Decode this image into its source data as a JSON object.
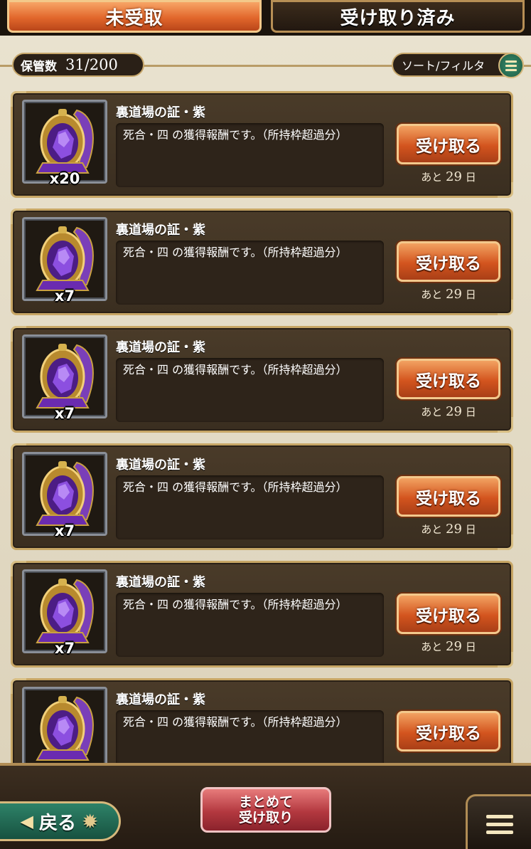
{
  "tabs": {
    "unclaimed": "未受取",
    "claimed": "受け取り済み"
  },
  "storage": {
    "label": "保管数",
    "value": "31/200"
  },
  "sort_filter": {
    "label": "ソート/フィルタ"
  },
  "items": [
    {
      "name": "裏道場の証・紫",
      "quantity": "x20",
      "description": "死合・四 の獲得報酬です。（所持枠超過分）",
      "button": "受け取る",
      "remaining_prefix": "あと",
      "remaining_days": "29",
      "remaining_suffix": "日"
    },
    {
      "name": "裏道場の証・紫",
      "quantity": "x7",
      "description": "死合・四 の獲得報酬です。（所持枠超過分）",
      "button": "受け取る",
      "remaining_prefix": "あと",
      "remaining_days": "29",
      "remaining_suffix": "日"
    },
    {
      "name": "裏道場の証・紫",
      "quantity": "x7",
      "description": "死合・四 の獲得報酬です。（所持枠超過分）",
      "button": "受け取る",
      "remaining_prefix": "あと",
      "remaining_days": "29",
      "remaining_suffix": "日"
    },
    {
      "name": "裏道場の証・紫",
      "quantity": "x7",
      "description": "死合・四 の獲得報酬です。（所持枠超過分）",
      "button": "受け取る",
      "remaining_prefix": "あと",
      "remaining_days": "29",
      "remaining_suffix": "日"
    },
    {
      "name": "裏道場の証・紫",
      "quantity": "x7",
      "description": "死合・四 の獲得報酬です。（所持枠超過分）",
      "button": "受け取る",
      "remaining_prefix": "あと",
      "remaining_days": "29",
      "remaining_suffix": "日"
    },
    {
      "name": "裏道場の証・紫",
      "quantity": "",
      "description": "死合・四 の獲得報酬です。（所持枠超過分）",
      "button": "受け取る",
      "remaining_prefix": "",
      "remaining_days": "",
      "remaining_suffix": ""
    }
  ],
  "bottom": {
    "back_label": "戻る",
    "claim_all_line1": "まとめて",
    "claim_all_line2": "受け取り"
  },
  "colors": {
    "tab_active": "#e2672c",
    "claim_button": "#d3541e",
    "claim_all_button": "#b3383f",
    "back_button": "#2e8268",
    "gem_purple": "#6a2bb0",
    "frame_gold": "#c7a665"
  },
  "icons": {
    "item": "purple-emblem-icon",
    "back": "back-arrow-icon",
    "gear": "gear-icon",
    "menu": "menu-icon"
  }
}
